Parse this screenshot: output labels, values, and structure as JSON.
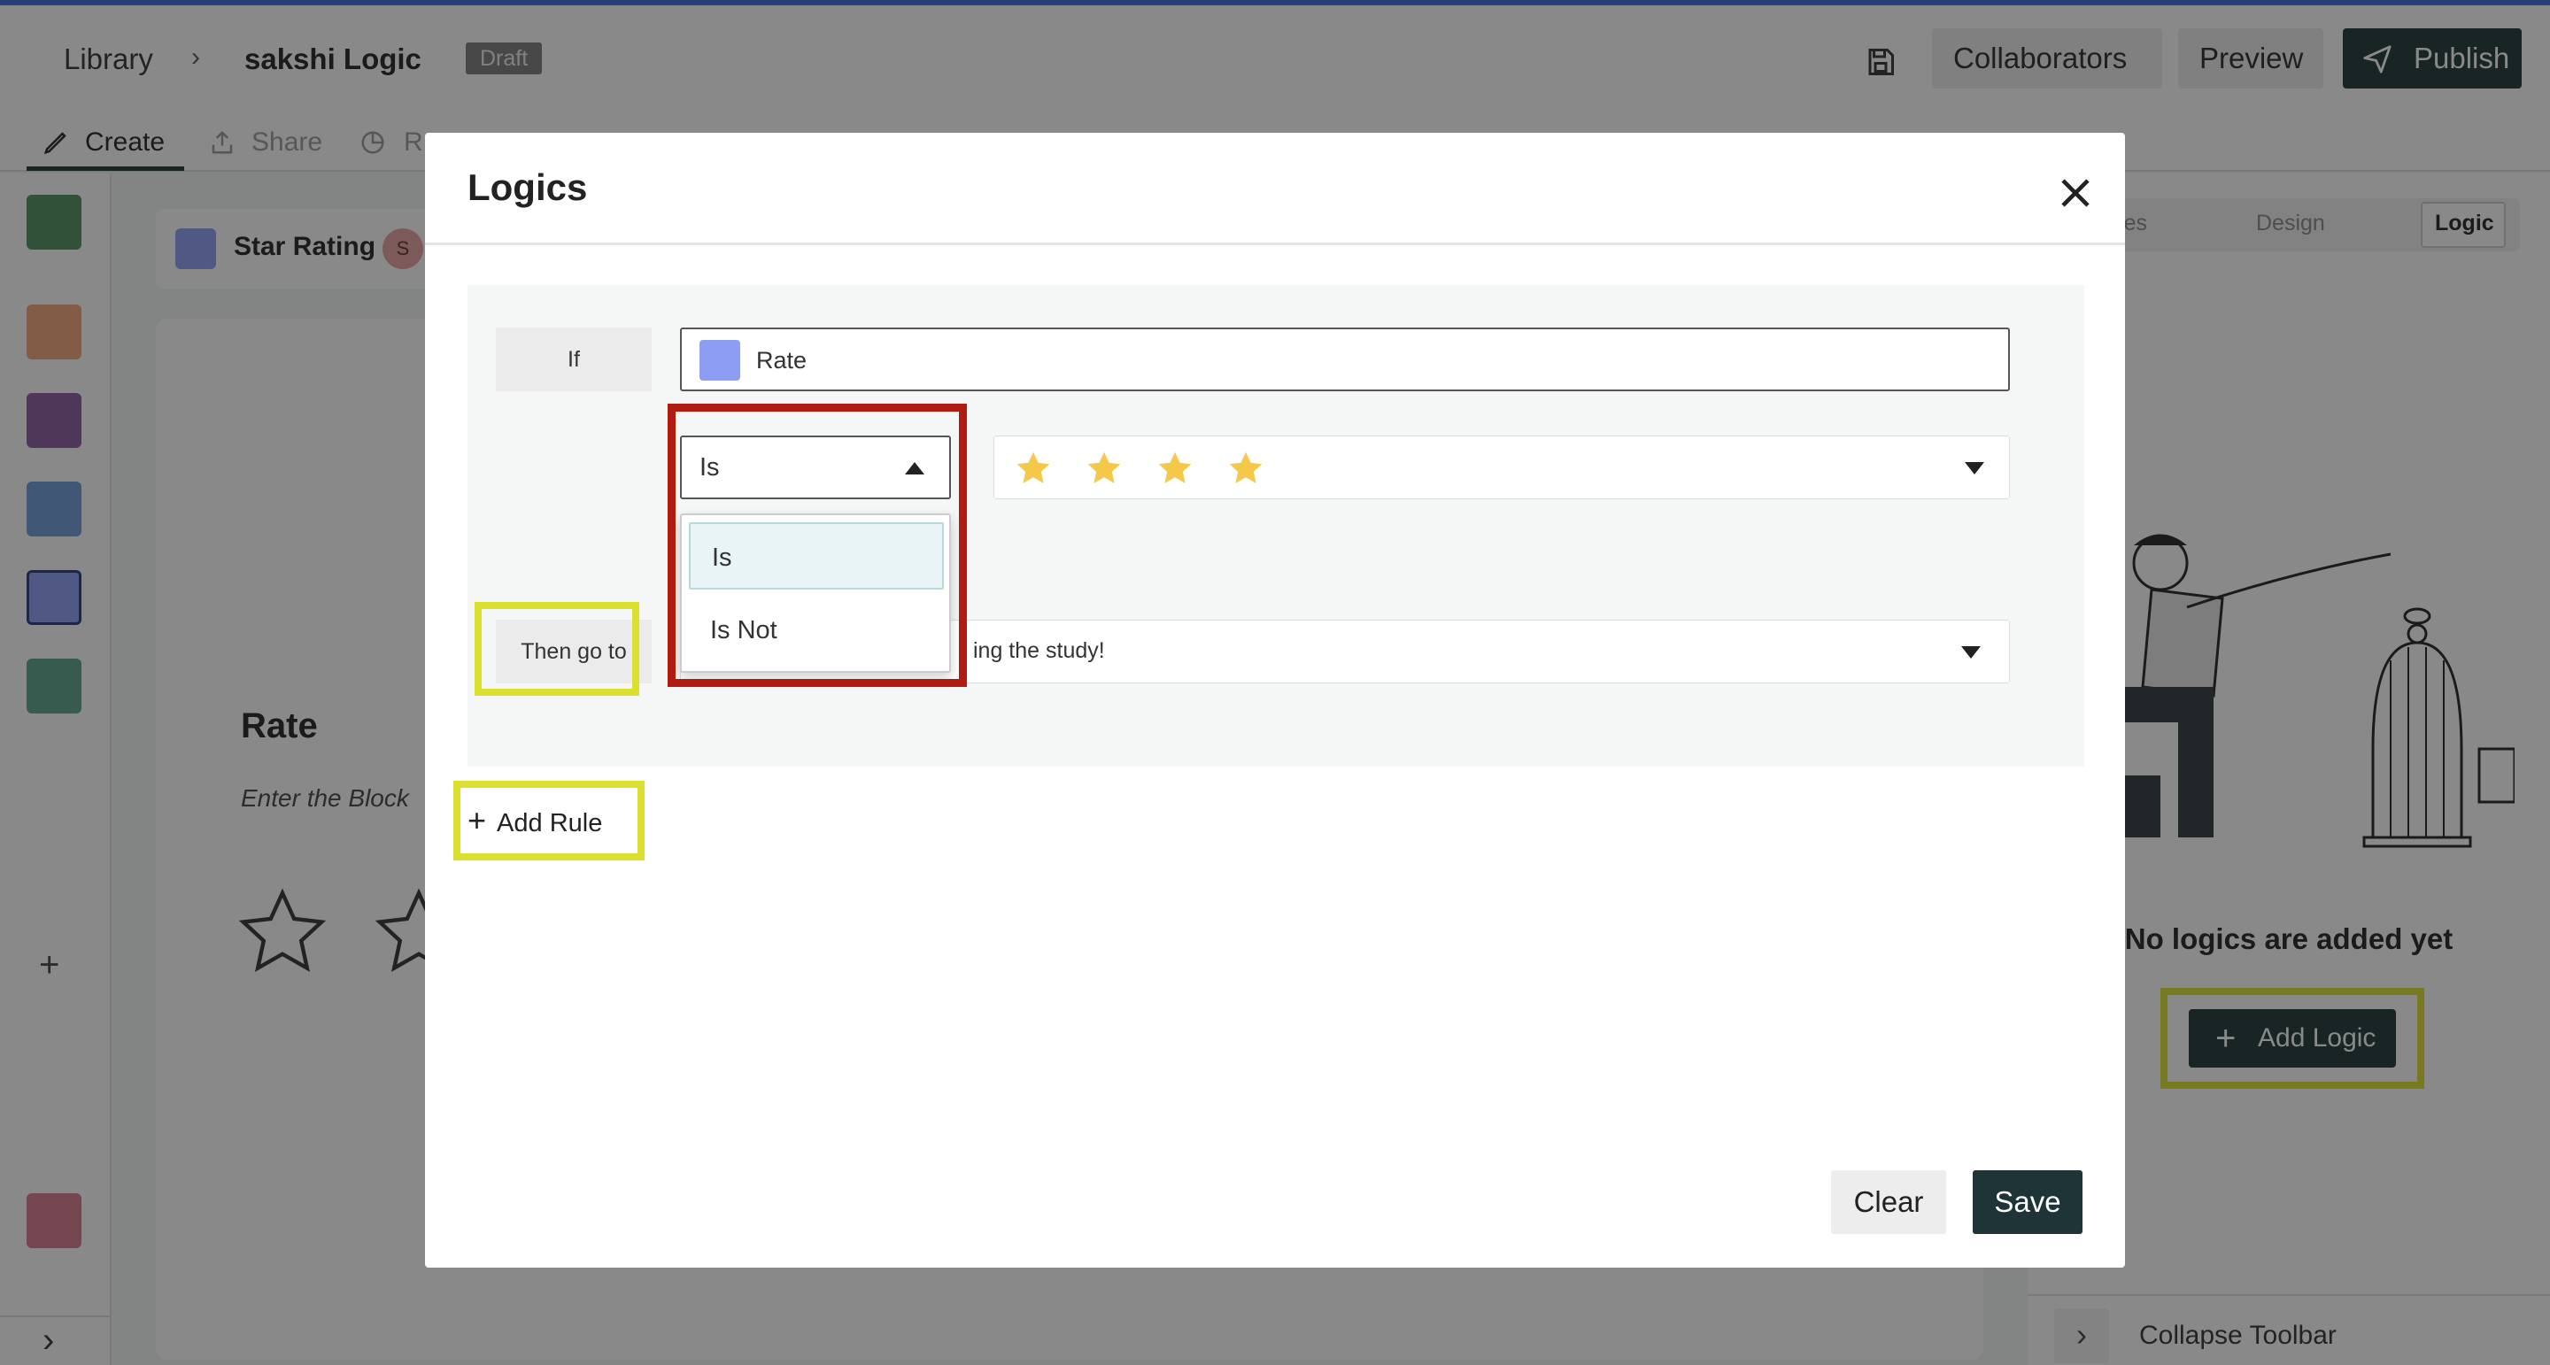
{
  "header": {
    "breadcrumb_root": "Library",
    "breadcrumb_sep": "›",
    "study_name": "sakshi Logic",
    "status_badge": "Draft",
    "collaborators_label": "Collaborators",
    "preview_label": "Preview",
    "publish_label": "Publish"
  },
  "tabs": {
    "create": "Create",
    "share": "Share",
    "results": "R"
  },
  "sidebar": {
    "add_label": "+",
    "expand_label": "›"
  },
  "block": {
    "type_label": "Star Rating",
    "avatar_initial": "S",
    "question_title": "Rate",
    "description_placeholder": "Enter the Block"
  },
  "right_panel": {
    "tab_properties": "perties",
    "tab_design": "Design",
    "tab_logic": "Logic",
    "empty_message": "No logics are added yet",
    "add_logic_label": "Add Logic",
    "collapse_label": "Collapse Toolbar"
  },
  "modal": {
    "title": "Logics",
    "if_label": "If",
    "question_select": "Rate",
    "operator_value": "Is",
    "operator_options": [
      "Is",
      "Is Not"
    ],
    "rating_value": 4,
    "then_label": "Then go to",
    "goto_value": "ing the study!",
    "add_rule_label": "Add Rule",
    "clear_label": "Clear",
    "save_label": "Save"
  },
  "colors": {
    "accent_dark": "#1e3436",
    "highlight_yellow": "#dbe02f",
    "highlight_red": "#b21c10",
    "star_fill": "#f5c84a",
    "topline": "#3a68d8"
  }
}
